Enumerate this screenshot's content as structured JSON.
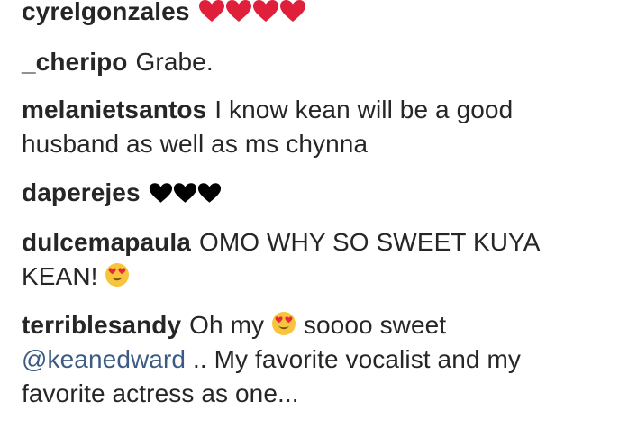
{
  "colors": {
    "text": "#262626",
    "mention": "#3b5b84",
    "red_heart": "#e0203a",
    "black_heart": "#000000",
    "emoji_face": "#f7c53b"
  },
  "comments": [
    {
      "username": "cyrelgonzales",
      "icons": [
        "red-heart-icon",
        "red-heart-icon",
        "red-heart-icon",
        "red-heart-icon"
      ]
    },
    {
      "username": "_cheripo",
      "text": "Grabe."
    },
    {
      "username": "melanietsantos",
      "text": "I know kean will be a good husband as well as ms chynna"
    },
    {
      "username": "daperejes",
      "icons": [
        "black-heart-icon",
        "black-heart-icon",
        "black-heart-icon"
      ]
    },
    {
      "username": "dulcemapaula",
      "text": "OMO WHY SO SWEET KUYA KEAN!",
      "icons": [
        "heart-eyes-emoji-icon"
      ]
    },
    {
      "username": "terriblesandy",
      "text_before": "Oh my",
      "icons": [
        "heart-eyes-emoji-icon"
      ],
      "text_after": "soooo sweet",
      "mention": "@keanedward",
      "text_end": ".. My favorite vocalist and my favorite actress as one..."
    }
  ]
}
